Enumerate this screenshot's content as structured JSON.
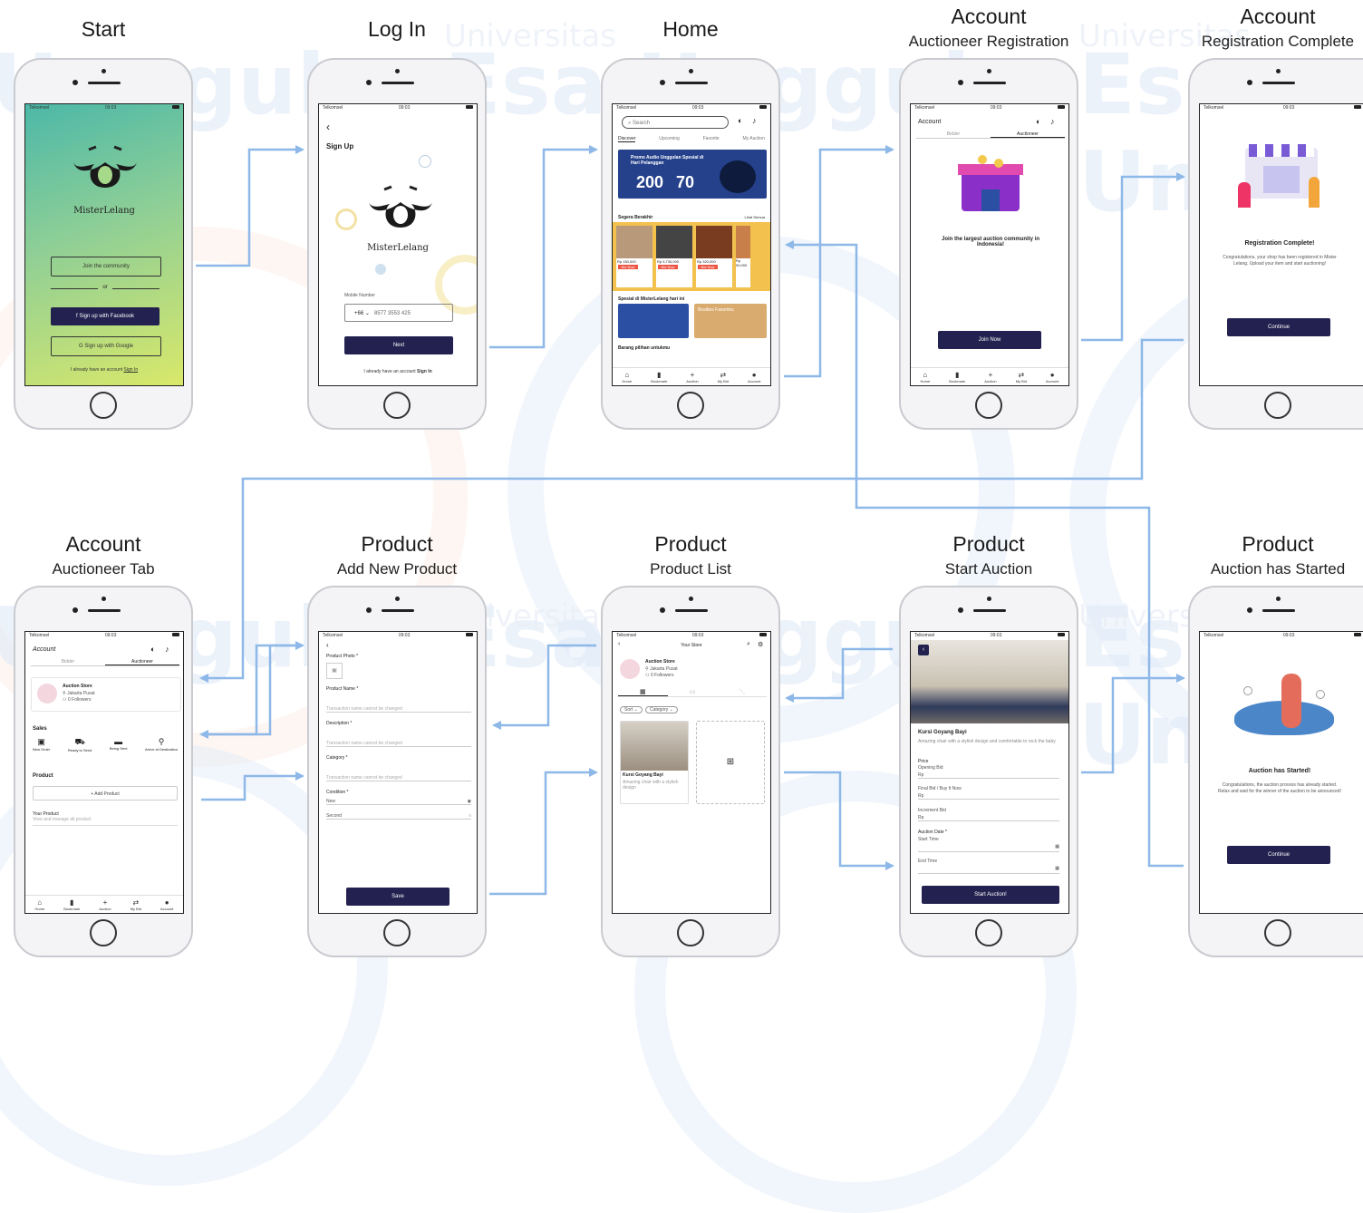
{
  "watermark": {
    "university": "Universitas",
    "name1": "Esa Unggul",
    "name2": "Unggul",
    "name3": "Esa Un"
  },
  "colors": {
    "arrow": "#8db8e8",
    "dark_button": "#23214f",
    "gradient_top": "#4cb8a8",
    "gradient_bottom": "#d9e86a"
  },
  "screens": [
    {
      "title": "Start",
      "subtitle": ""
    },
    {
      "title": "Log In",
      "subtitle": ""
    },
    {
      "title": "Home",
      "subtitle": ""
    },
    {
      "title": "Account",
      "subtitle": "Auctioneer Registration"
    },
    {
      "title": "Account",
      "subtitle": "Registration Complete"
    },
    {
      "title": "Account",
      "subtitle": "Auctioneer Tab"
    },
    {
      "title": "Product",
      "subtitle": "Add New Product"
    },
    {
      "title": "Product",
      "subtitle": "Product List"
    },
    {
      "title": "Product",
      "subtitle": "Start Auction"
    },
    {
      "title": "Product",
      "subtitle": "Auction has Started"
    }
  ],
  "status": {
    "carrier": "Telkomsel",
    "time": "09:03"
  },
  "brand": "MisterLelang",
  "start": {
    "join": "Join the community",
    "or": "or",
    "facebook": "Sign up with Facebook",
    "google": "Sign up with Google",
    "have_account": "I already have an account",
    "sign_in": "Sign In"
  },
  "login": {
    "heading": "Sign Up",
    "mobile_label": "Mobile Number",
    "country_code": "+66",
    "phone": "8577 3553 425",
    "next": "Next",
    "have_account": "I already have an account",
    "sign_in": "Sign In"
  },
  "home": {
    "search": "Search",
    "tabs": [
      "Discover",
      "Upcoming",
      "Favorite",
      "My Auction"
    ],
    "promo_title": "Promo Audio Unggulan Spesial di Hari Pelanggan",
    "promo_price1": "200",
    "promo_price2": "70",
    "section1": "Segera Berakhir",
    "see_all": "Lihat Semua",
    "items": [
      {
        "price": "Rp 150,000",
        "badge": "Bid Now"
      },
      {
        "price": "Rp 5,730,000",
        "badge": "Bid Now"
      },
      {
        "price": "Rp 320,000",
        "badge": "Bid Now"
      },
      {
        "price": "Rp 90,000",
        "badge": "Bid"
      }
    ],
    "section2": "Spesial di MisterLelang hari ini",
    "promo_b": "Bestties Favorites",
    "section3": "Barang pilihan untukmu",
    "nav": [
      "Home",
      "Bookmark",
      "Auction",
      "My Bid",
      "Account"
    ]
  },
  "reg": {
    "heading": "Account",
    "tabs": [
      "Bidder",
      "Auctioneer"
    ],
    "text": "Join the largest auction community in Indonesia!",
    "button": "Join Now"
  },
  "complete": {
    "heading": "Registration Complete!",
    "text": "Congratulations, your shop has been registered in Mister Lelang. Upload your item and start auctioning!",
    "button": "Continue"
  },
  "tab": {
    "heading": "Account",
    "tabs": [
      "Bidder",
      "Auctioneer"
    ],
    "store_name": "Auction Store",
    "store_city": "Jakarta Pusat",
    "store_followers": "0 Followers",
    "sales": "Sales",
    "sales_items": [
      "New Order",
      "Ready to Send",
      "Being Sent",
      "Arrive at Destination"
    ],
    "product": "Product",
    "add_product": "+ Add Product",
    "your_product": "Your Product",
    "your_product_sub": "View and manage all product"
  },
  "add": {
    "photo": "Product Photo *",
    "name": "Product Name *",
    "name_ph": "Transaction name cannot be changed",
    "desc": "Description *",
    "desc_ph": "Transaction name cannot be changed",
    "cat": "Category *",
    "cat_ph": "Transaction name cannot be changed",
    "cond": "Condition *",
    "cond_new": "New",
    "cond_second": "Second",
    "save": "Save"
  },
  "list": {
    "heading": "Your Store",
    "store_name": "Auction Store",
    "store_city": "Jakarta Pusat",
    "store_followers": "0 Followers",
    "filters": [
      "Sort",
      "Category"
    ],
    "product_name": "Kursi Goyang Bayi",
    "product_desc": "Amazing chair with a stylish design"
  },
  "start_auction": {
    "product_name": "Kursi Goyang Bayi",
    "product_desc": "Amazing chair with a stylish design and comfortable to rock the baby",
    "price_label": "Price",
    "opening_bid": "Opening Bid",
    "rp1": "Rp",
    "buy_now": "Final Bid / Buy It Now",
    "rp2": "Rp",
    "increment": "Increment Bid",
    "rp3": "Rp",
    "date_label": "Auction Date *",
    "start_time": "Start Time",
    "end_time": "End Time",
    "button": "Start Auction!"
  },
  "started": {
    "heading": "Auction has Started!",
    "text": "Congratulations, the auction process has already started. Relax and wait for the winner of the auction to be announced!",
    "button": "Continue"
  }
}
